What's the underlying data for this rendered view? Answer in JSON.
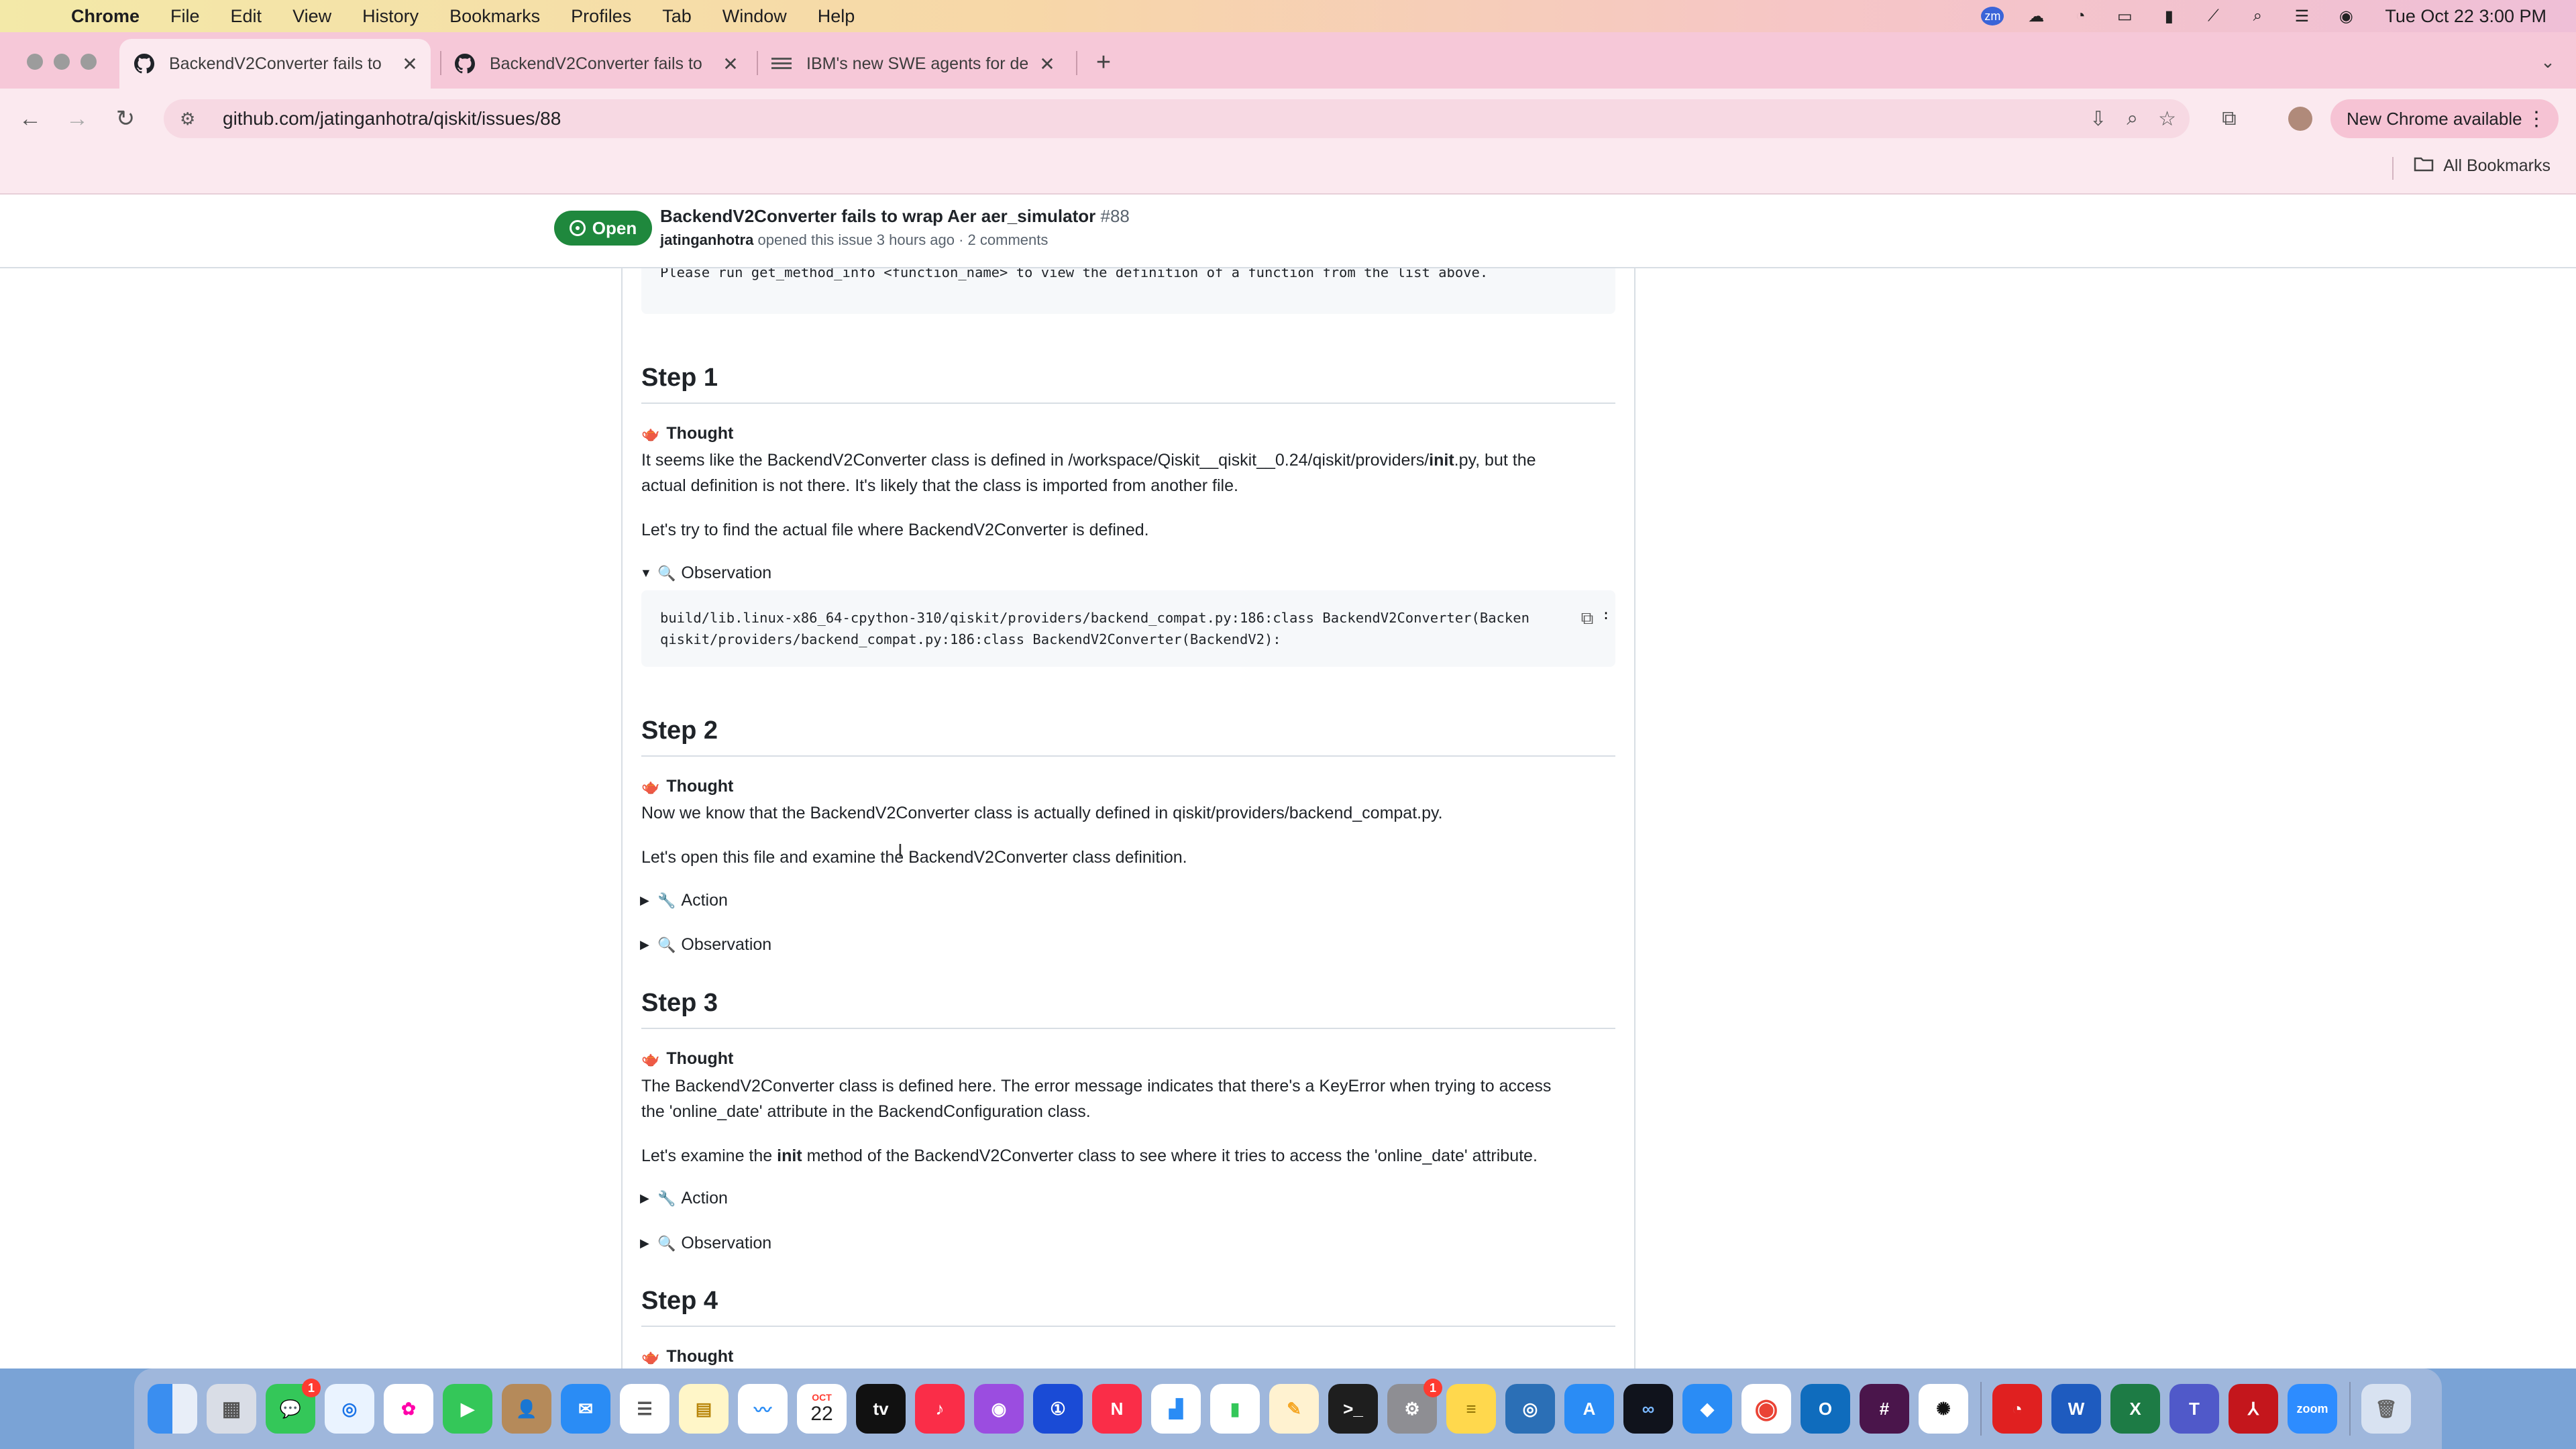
{
  "menubar": {
    "app": "Chrome",
    "items": [
      "File",
      "Edit",
      "View",
      "History",
      "Bookmarks",
      "Profiles",
      "Tab",
      "Window",
      "Help"
    ],
    "clock": "Tue Oct 22  3:00 PM"
  },
  "tabs": [
    {
      "label": "BackendV2Converter fails to",
      "icon": "github-icon",
      "active": true
    },
    {
      "label": "BackendV2Converter fails to",
      "icon": "github-icon",
      "active": false
    },
    {
      "label": "IBM's new SWE agents for de",
      "icon": "ibm-icon",
      "active": false
    }
  ],
  "toolbar": {
    "url": "github.com/jatinganhotra/qiskit/issues/88",
    "new_chrome": "New Chrome available"
  },
  "bookmarks": {
    "all": "All Bookmarks"
  },
  "issue": {
    "state": "Open",
    "title": "BackendV2Converter fails to wrap Aer aer_simulator",
    "number": "#88",
    "author": "jatinganhotra",
    "meta": "opened this issue 3 hours ago · 2 comments"
  },
  "content": {
    "top_code": "Please run get_method_info <function_name> to view the definition of a function from the list above.",
    "step1": {
      "heading": "Step 1",
      "thought_label": "Thought",
      "p1a": "It seems like the BackendV2Converter class is defined in /workspace/Qiskit__qiskit__0.24/qiskit/providers/",
      "p1b": "init",
      "p1c": ".py, but the",
      "p1d": "actual definition is not there. It's likely that the class is imported from another file.",
      "p2": "Let's try to find the actual file where BackendV2Converter is defined.",
      "observation_label": "Observation",
      "code1": "build/lib.linux-x86_64-cpython-310/qiskit/providers/backend_compat.py:186:class BackendV2Converter(Backen",
      "code2": "qiskit/providers/backend_compat.py:186:class BackendV2Converter(BackendV2):"
    },
    "step2": {
      "heading": "Step 2",
      "thought_label": "Thought",
      "p1": "Now we know that the BackendV2Converter class is actually defined in qiskit/providers/backend_compat.py.",
      "p2": "Let's open this file and examine the BackendV2Converter class definition.",
      "action_label": "Action",
      "observation_label": "Observation"
    },
    "step3": {
      "heading": "Step 3",
      "thought_label": "Thought",
      "p1a": "The BackendV2Converter class is defined here. The error message indicates that there's a KeyError when trying to access",
      "p1b": "the 'online_date' attribute in the BackendConfiguration class.",
      "p2a": "Let's examine the ",
      "p2b": "init",
      "p2c": " method of the BackendV2Converter class to see where it tries to access the 'online_date' attribute.",
      "action_label": "Action",
      "observation_label": "Observation"
    },
    "step4": {
      "heading": "Step 4",
      "thought_label": "Thought"
    }
  },
  "dock": {
    "apps": [
      "Finder",
      "Launchpad",
      "Messages",
      "Safari",
      "Photos",
      "FaceTime",
      "Contacts",
      "Mail",
      "Reminders",
      "Notes",
      "Freeform",
      "Calendar",
      "TV",
      "Music",
      "Podcasts",
      "1Password",
      "News",
      "Keynote",
      "Numbers",
      "Pages",
      "Terminal",
      "System Settings",
      "Stickies",
      "Proxyman",
      "App Store",
      "Copilot",
      "Safari Tech",
      "Chrome",
      "Outlook",
      "Slack",
      "ChatGPT",
      "Acrobat",
      "Word",
      "Excel",
      "Teams",
      "Adobe",
      "Zoom",
      "Trash"
    ],
    "calendar_month": "OCT",
    "calendar_day": "22",
    "messages_badge": "1",
    "settings_badge": "1"
  }
}
